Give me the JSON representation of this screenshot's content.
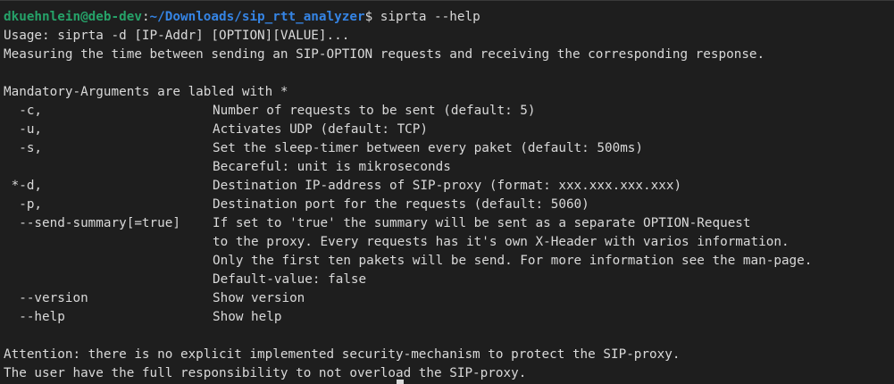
{
  "prompt": {
    "user_host": "dkuehnlein@deb-dev",
    "separator": ":",
    "path": "~/Downloads/sip_rtt_analyzer",
    "dollar": "$",
    "command": " siprta --help"
  },
  "usage": "Usage: siprta -d [IP-Addr] [OPTION][VALUE]...",
  "description": "Measuring the time between sending an SIP-OPTION requests and receiving the corresponding response.",
  "mandatory_note": "Mandatory-Arguments are labled with *",
  "options": [
    {
      "name": "  -c,",
      "desc": "Number of requests to be sent (default: 5)"
    },
    {
      "name": "  -u,",
      "desc": "Activates UDP (default: TCP)"
    },
    {
      "name": "  -s,",
      "desc": "Set the sleep-timer between every paket (default: 500ms)"
    },
    {
      "name": "",
      "desc": "Becareful: unit is mikroseconds"
    },
    {
      "name": " *-d,",
      "desc": "Destination IP-address of SIP-proxy (format: xxx.xxx.xxx.xxx)"
    },
    {
      "name": "  -p,",
      "desc": "Destination port for the requests (default: 5060)"
    },
    {
      "name": "  --send-summary[=true]",
      "desc": "If set to 'true' the summary will be sent as a separate OPTION-Request"
    },
    {
      "name": "",
      "desc": "to the proxy. Every requests has it's own X-Header with varios information."
    },
    {
      "name": "",
      "desc": "Only the first ten pakets will be send. For more information see the man-page."
    },
    {
      "name": "",
      "desc": "Default-value: false"
    },
    {
      "name": "  --version",
      "desc": "Show version"
    },
    {
      "name": "  --help",
      "desc": "Show help"
    }
  ],
  "attention": [
    "Attention: there is no explicit implemented security-mechanism to protect the SIP-proxy.",
    "The user have the full responsibility to not overload the SIP-proxy."
  ],
  "colors": {
    "background": "#1e1e1e",
    "foreground": "#d9d9d9",
    "prompt_user": "#26a269",
    "prompt_path": "#3584e4"
  }
}
